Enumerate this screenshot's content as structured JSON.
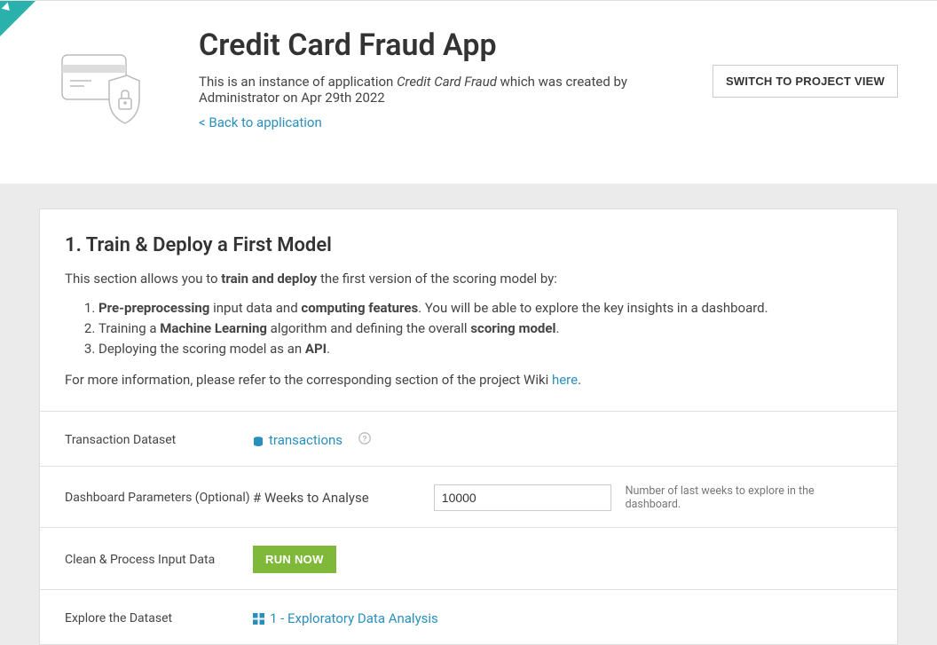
{
  "header": {
    "title": "Credit Card Fraud App",
    "instance_prefix": "This is an instance of application ",
    "app_name": "Credit Card Fraud",
    "instance_suffix": " which was created by Administrator on Apr 29th 2022",
    "back_link": "< Back to application",
    "switch_button": "SWITCH TO PROJECT VIEW"
  },
  "section1": {
    "title": "1. Train & Deploy a First Model",
    "intro_prefix": "This section allows you to ",
    "intro_bold": "train and deploy",
    "intro_suffix": " the first version of the scoring model by:",
    "li1_b1": "Pre-preprocessing",
    "li1_t1": " input data and ",
    "li1_b2": "computing features",
    "li1_t2": ". You will be able to explore the key insights in a dashboard.",
    "li2_t1": "Training a ",
    "li2_b1": "Machine Learning",
    "li2_t2": " algorithm and defining the overall ",
    "li2_b2": "scoring model",
    "li2_t3": ".",
    "li3_t1": "Deploying the scoring model as an ",
    "li3_b1": "API",
    "li3_t2": ".",
    "more_info_prefix": "For more information, please refer to the corresponding section of the project Wiki ",
    "more_info_link": "here",
    "more_info_suffix": "."
  },
  "form": {
    "transaction_label": "Transaction Dataset",
    "transaction_value": "transactions",
    "dashboard_params_label": "Dashboard Parameters (Optional)",
    "weeks_label": "# Weeks to Analyse",
    "weeks_value": "10000",
    "weeks_hint": "Number of last weeks to explore in the dashboard.",
    "clean_label": "Clean & Process Input Data",
    "run_now": "RUN NOW",
    "explore_label": "Explore the Dataset",
    "explore_link": "1 - Exploratory Data Analysis"
  }
}
